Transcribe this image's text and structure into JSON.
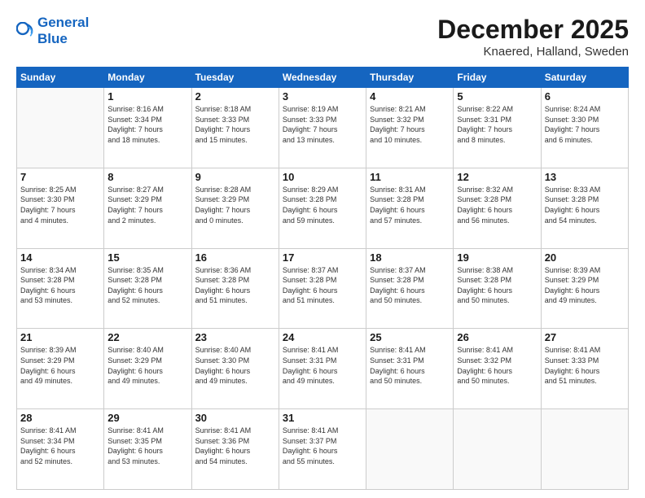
{
  "logo": {
    "line1": "General",
    "line2": "Blue"
  },
  "title": "December 2025",
  "location": "Knaered, Halland, Sweden",
  "days_header": [
    "Sunday",
    "Monday",
    "Tuesday",
    "Wednesday",
    "Thursday",
    "Friday",
    "Saturday"
  ],
  "weeks": [
    [
      {
        "day": "",
        "info": ""
      },
      {
        "day": "1",
        "info": "Sunrise: 8:16 AM\nSunset: 3:34 PM\nDaylight: 7 hours\nand 18 minutes."
      },
      {
        "day": "2",
        "info": "Sunrise: 8:18 AM\nSunset: 3:33 PM\nDaylight: 7 hours\nand 15 minutes."
      },
      {
        "day": "3",
        "info": "Sunrise: 8:19 AM\nSunset: 3:33 PM\nDaylight: 7 hours\nand 13 minutes."
      },
      {
        "day": "4",
        "info": "Sunrise: 8:21 AM\nSunset: 3:32 PM\nDaylight: 7 hours\nand 10 minutes."
      },
      {
        "day": "5",
        "info": "Sunrise: 8:22 AM\nSunset: 3:31 PM\nDaylight: 7 hours\nand 8 minutes."
      },
      {
        "day": "6",
        "info": "Sunrise: 8:24 AM\nSunset: 3:30 PM\nDaylight: 7 hours\nand 6 minutes."
      }
    ],
    [
      {
        "day": "7",
        "info": "Sunrise: 8:25 AM\nSunset: 3:30 PM\nDaylight: 7 hours\nand 4 minutes."
      },
      {
        "day": "8",
        "info": "Sunrise: 8:27 AM\nSunset: 3:29 PM\nDaylight: 7 hours\nand 2 minutes."
      },
      {
        "day": "9",
        "info": "Sunrise: 8:28 AM\nSunset: 3:29 PM\nDaylight: 7 hours\nand 0 minutes."
      },
      {
        "day": "10",
        "info": "Sunrise: 8:29 AM\nSunset: 3:28 PM\nDaylight: 6 hours\nand 59 minutes."
      },
      {
        "day": "11",
        "info": "Sunrise: 8:31 AM\nSunset: 3:28 PM\nDaylight: 6 hours\nand 57 minutes."
      },
      {
        "day": "12",
        "info": "Sunrise: 8:32 AM\nSunset: 3:28 PM\nDaylight: 6 hours\nand 56 minutes."
      },
      {
        "day": "13",
        "info": "Sunrise: 8:33 AM\nSunset: 3:28 PM\nDaylight: 6 hours\nand 54 minutes."
      }
    ],
    [
      {
        "day": "14",
        "info": "Sunrise: 8:34 AM\nSunset: 3:28 PM\nDaylight: 6 hours\nand 53 minutes."
      },
      {
        "day": "15",
        "info": "Sunrise: 8:35 AM\nSunset: 3:28 PM\nDaylight: 6 hours\nand 52 minutes."
      },
      {
        "day": "16",
        "info": "Sunrise: 8:36 AM\nSunset: 3:28 PM\nDaylight: 6 hours\nand 51 minutes."
      },
      {
        "day": "17",
        "info": "Sunrise: 8:37 AM\nSunset: 3:28 PM\nDaylight: 6 hours\nand 51 minutes."
      },
      {
        "day": "18",
        "info": "Sunrise: 8:37 AM\nSunset: 3:28 PM\nDaylight: 6 hours\nand 50 minutes."
      },
      {
        "day": "19",
        "info": "Sunrise: 8:38 AM\nSunset: 3:28 PM\nDaylight: 6 hours\nand 50 minutes."
      },
      {
        "day": "20",
        "info": "Sunrise: 8:39 AM\nSunset: 3:29 PM\nDaylight: 6 hours\nand 49 minutes."
      }
    ],
    [
      {
        "day": "21",
        "info": "Sunrise: 8:39 AM\nSunset: 3:29 PM\nDaylight: 6 hours\nand 49 minutes."
      },
      {
        "day": "22",
        "info": "Sunrise: 8:40 AM\nSunset: 3:29 PM\nDaylight: 6 hours\nand 49 minutes."
      },
      {
        "day": "23",
        "info": "Sunrise: 8:40 AM\nSunset: 3:30 PM\nDaylight: 6 hours\nand 49 minutes."
      },
      {
        "day": "24",
        "info": "Sunrise: 8:41 AM\nSunset: 3:31 PM\nDaylight: 6 hours\nand 49 minutes."
      },
      {
        "day": "25",
        "info": "Sunrise: 8:41 AM\nSunset: 3:31 PM\nDaylight: 6 hours\nand 50 minutes."
      },
      {
        "day": "26",
        "info": "Sunrise: 8:41 AM\nSunset: 3:32 PM\nDaylight: 6 hours\nand 50 minutes."
      },
      {
        "day": "27",
        "info": "Sunrise: 8:41 AM\nSunset: 3:33 PM\nDaylight: 6 hours\nand 51 minutes."
      }
    ],
    [
      {
        "day": "28",
        "info": "Sunrise: 8:41 AM\nSunset: 3:34 PM\nDaylight: 6 hours\nand 52 minutes."
      },
      {
        "day": "29",
        "info": "Sunrise: 8:41 AM\nSunset: 3:35 PM\nDaylight: 6 hours\nand 53 minutes."
      },
      {
        "day": "30",
        "info": "Sunrise: 8:41 AM\nSunset: 3:36 PM\nDaylight: 6 hours\nand 54 minutes."
      },
      {
        "day": "31",
        "info": "Sunrise: 8:41 AM\nSunset: 3:37 PM\nDaylight: 6 hours\nand 55 minutes."
      },
      {
        "day": "",
        "info": ""
      },
      {
        "day": "",
        "info": ""
      },
      {
        "day": "",
        "info": ""
      }
    ]
  ]
}
